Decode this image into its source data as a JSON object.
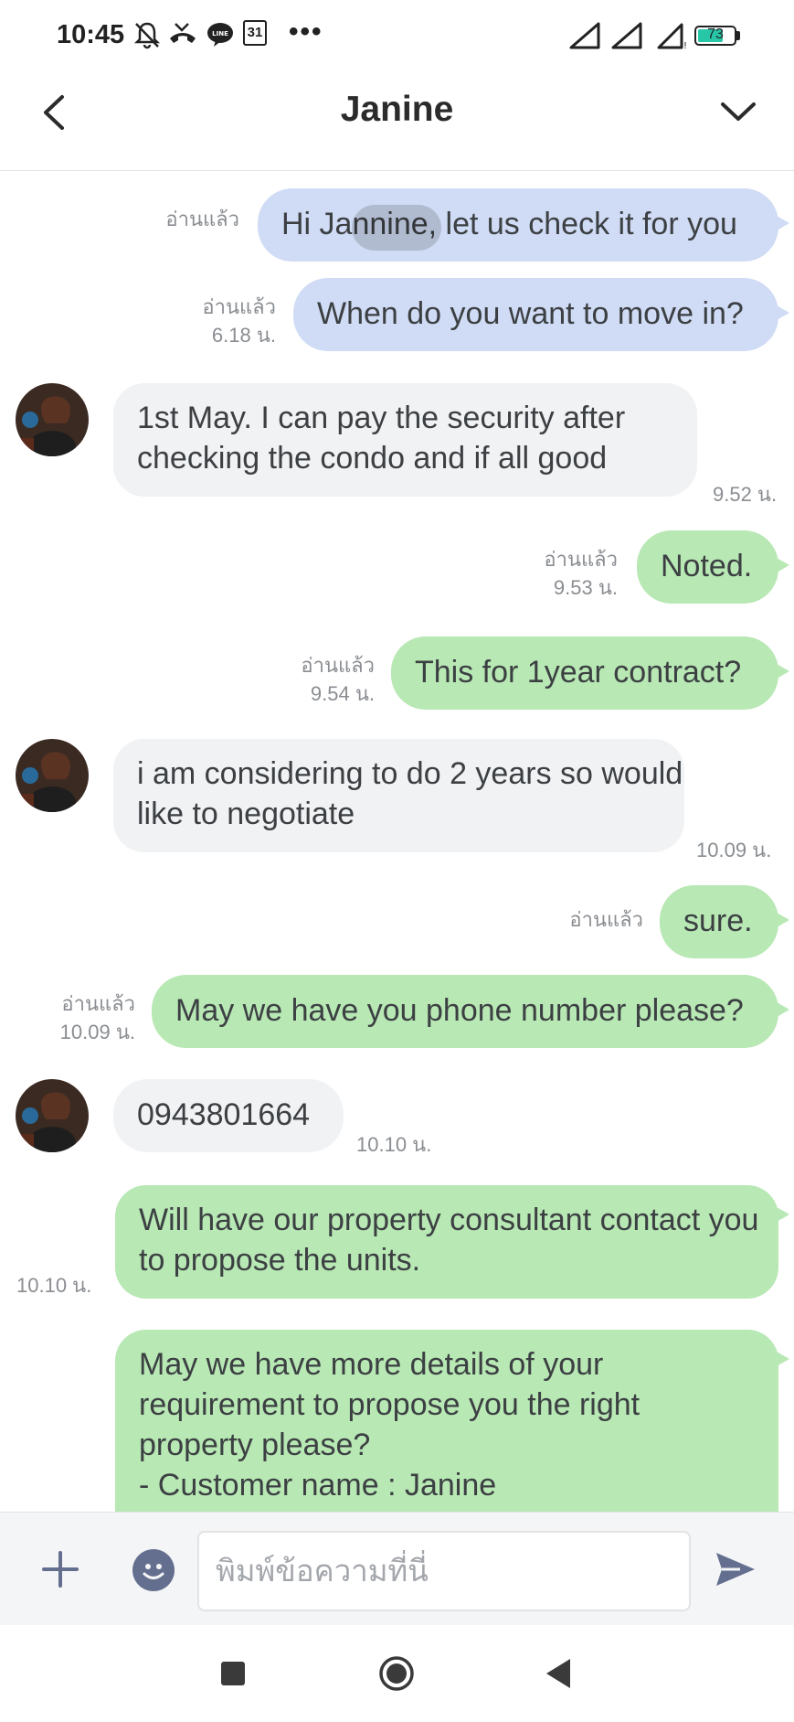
{
  "status_bar": {
    "time": "10:45",
    "icons": [
      "notifications-off-icon",
      "missed-call-icon",
      "line-app-icon",
      "calendar-icon",
      "more-icon",
      "signal-icon",
      "signal-icon",
      "signal-icon",
      "battery-icon"
    ],
    "calendar_day": "31",
    "more": "•••",
    "battery_percent": "73",
    "battery_level": 0.73
  },
  "header": {
    "title": "Janine"
  },
  "messages": [
    {
      "dir": "out",
      "color": "blue",
      "text": "Hi Jannine, let us check it for you",
      "read": "อ่านแล้ว",
      "time": ""
    },
    {
      "dir": "out",
      "color": "blue",
      "text": "When do you want to move in?",
      "read": "อ่านแล้ว",
      "time": "6.18 น."
    },
    {
      "dir": "in",
      "text": "1st May. I can pay the security after checking the condo and if all good",
      "time": "9.52 น."
    },
    {
      "dir": "out",
      "color": "green",
      "text": "Noted.",
      "read": "อ่านแล้ว",
      "time": "9.53 น."
    },
    {
      "dir": "out",
      "color": "green",
      "text": "This for 1year contract?",
      "read": "อ่านแล้ว",
      "time": "9.54 น."
    },
    {
      "dir": "in",
      "text": "i am considering to do 2 years so would like to negotiate",
      "time": "10.09 น."
    },
    {
      "dir": "out",
      "color": "green",
      "text": "sure.",
      "read": "อ่านแล้ว",
      "time": ""
    },
    {
      "dir": "out",
      "color": "green",
      "text": "May we have you phone number please?",
      "read": "อ่านแล้ว",
      "time": "10.09 น."
    },
    {
      "dir": "in",
      "text": "0943801664",
      "time": "10.10 น."
    },
    {
      "dir": "out",
      "color": "green",
      "text": "Will have our property consultant contact you to propose the units.",
      "read": "",
      "time": "10.10 น."
    },
    {
      "dir": "out",
      "color": "green",
      "text": "May we have more details of your requirement to propose you the right property please?\n- Customer name : Janine",
      "read": "",
      "time": ""
    }
  ],
  "input": {
    "placeholder": "พิมพ์ข้อความที่นี่"
  },
  "colors": {
    "outgoing_blue": "#d0dcf5",
    "outgoing_green": "#b8e8b4",
    "incoming": "#f1f2f4",
    "meta_text": "#8a8d91"
  }
}
